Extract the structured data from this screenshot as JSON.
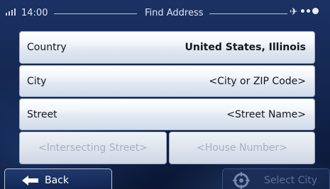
{
  "status_bar": {
    "time": "14:00",
    "title": "Find Address",
    "icons": [
      "signal-icon",
      "gps-icon",
      "status-dots-icon"
    ]
  },
  "fields": {
    "country": {
      "label": "Country",
      "value": "United States, Illinois"
    },
    "city": {
      "label": "City",
      "value": "<City or ZIP Code>"
    },
    "street": {
      "label": "Street",
      "value": "<Street Name>"
    },
    "intersecting_street": {
      "placeholder": "<Intersecting Street>",
      "enabled": false
    },
    "house_number": {
      "placeholder": "<House Number>",
      "enabled": false
    }
  },
  "bottom_bar": {
    "back_label": "Back",
    "select_city_label": "Select City",
    "select_city_enabled": false
  },
  "colors": {
    "background": "#12244c",
    "field_text": "#14171c",
    "disabled_text": "#a7b0bf"
  }
}
